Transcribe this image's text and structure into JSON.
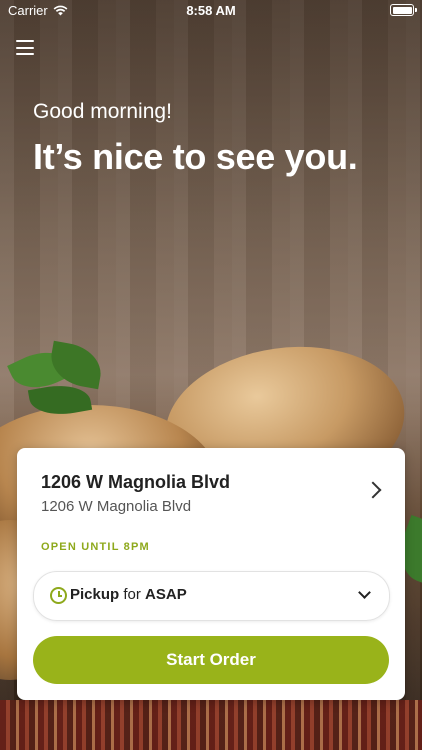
{
  "status_bar": {
    "carrier": "Carrier",
    "time": "8:58 AM"
  },
  "header": {
    "greeting": "Good morning!",
    "headline": "It’s nice to see you."
  },
  "location": {
    "name": "1206 W Magnolia Blvd",
    "address": "1206 W Magnolia Blvd",
    "hours": "OPEN UNTIL 8PM"
  },
  "order_mode": {
    "mode": "Pickup",
    "connector": " for ",
    "time": "ASAP"
  },
  "cta": {
    "label": "Start Order"
  },
  "colors": {
    "accent": "#99b31a",
    "hours_text": "#8ea91c"
  },
  "icons": [
    "wifi-icon",
    "battery-icon",
    "menu-icon",
    "chevron-right-icon",
    "clock-icon",
    "chevron-down-icon"
  ]
}
